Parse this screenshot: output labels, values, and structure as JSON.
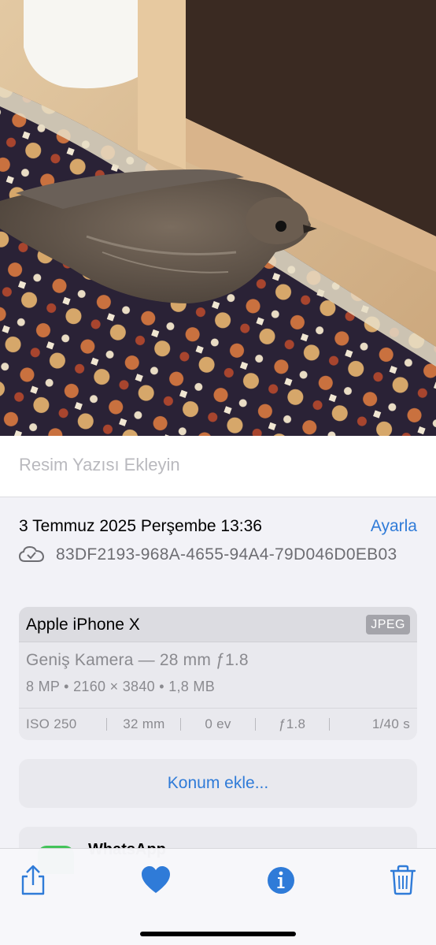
{
  "caption": {
    "placeholder": "Resim Yazısı Ekleyin"
  },
  "info": {
    "datetime": "3 Temmuz 2025 Perşembe 13:36",
    "adjust_label": "Ayarla",
    "file_name": "83DF2193-968A-4655-94A4-79D046D0EB03",
    "file_icon": "cloud-check-icon"
  },
  "device": {
    "name": "Apple iPhone X",
    "format": "JPEG",
    "lens": "Geniş Kamera — 28 mm ƒ1.8",
    "specs": "8 MP  •  2160 × 3840  •  1,8 MB",
    "exif": {
      "iso": "ISO 250",
      "focal": "32 mm",
      "ev": "0 ev",
      "aperture": "ƒ1.8",
      "shutter": "1/40 s"
    }
  },
  "location_button": "Konum ekle...",
  "app": {
    "name": "WhatsApp"
  },
  "toolbar": {
    "share_icon": "share-icon",
    "favorite_icon": "heart-icon",
    "info_icon": "info-icon",
    "delete_icon": "trash-icon"
  },
  "colors": {
    "accent": "#2f7bd8",
    "sheet_bg": "#f2f2f7",
    "card_bg": "#e9e9ee"
  }
}
